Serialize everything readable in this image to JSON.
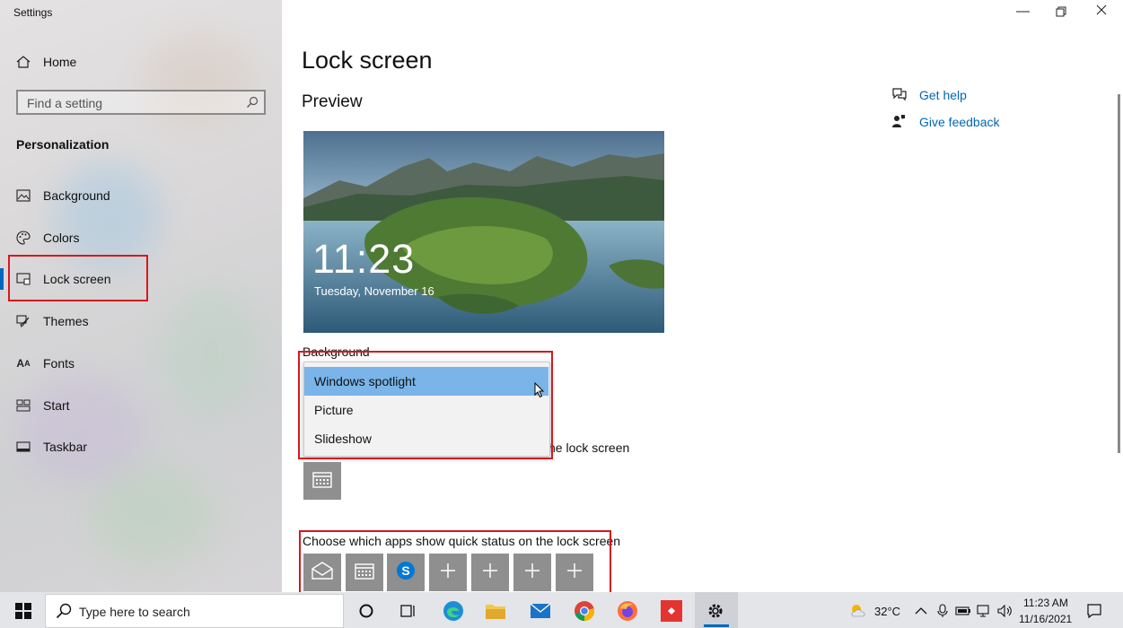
{
  "window": {
    "title": "Settings"
  },
  "sidebar": {
    "home_label": "Home",
    "search_placeholder": "Find a setting",
    "section_title": "Personalization",
    "items": [
      {
        "label": "Background",
        "icon": "picture-icon"
      },
      {
        "label": "Colors",
        "icon": "palette-icon"
      },
      {
        "label": "Lock screen",
        "icon": "lock-screen-icon",
        "active": true
      },
      {
        "label": "Themes",
        "icon": "brush-icon"
      },
      {
        "label": "Fonts",
        "icon": "font-icon"
      },
      {
        "label": "Start",
        "icon": "start-icon"
      },
      {
        "label": "Taskbar",
        "icon": "taskbar-icon"
      }
    ]
  },
  "main": {
    "page_title": "Lock screen",
    "preview_title": "Preview",
    "preview": {
      "time": "11:23",
      "date": "Tuesday, November 16"
    },
    "background_label": "Background",
    "background_dropdown": {
      "options": [
        "Windows spotlight",
        "Picture",
        "Slideshow"
      ],
      "selected": "Windows spotlight"
    },
    "detailed_status_label_partial": "he lock screen",
    "quick_status_label": "Choose which apps show quick status on the lock screen"
  },
  "help": {
    "get_help": "Get help",
    "give_feedback": "Give feedback"
  },
  "taskbar": {
    "search_placeholder": "Type here to search",
    "weather_temp": "32°C",
    "time": "11:23 AM",
    "date": "11/16/2021"
  },
  "colors": {
    "accent": "#0067c0",
    "highlight": "#7ab4e8",
    "annotation_red": "#d6181f",
    "link": "#0067b8"
  }
}
